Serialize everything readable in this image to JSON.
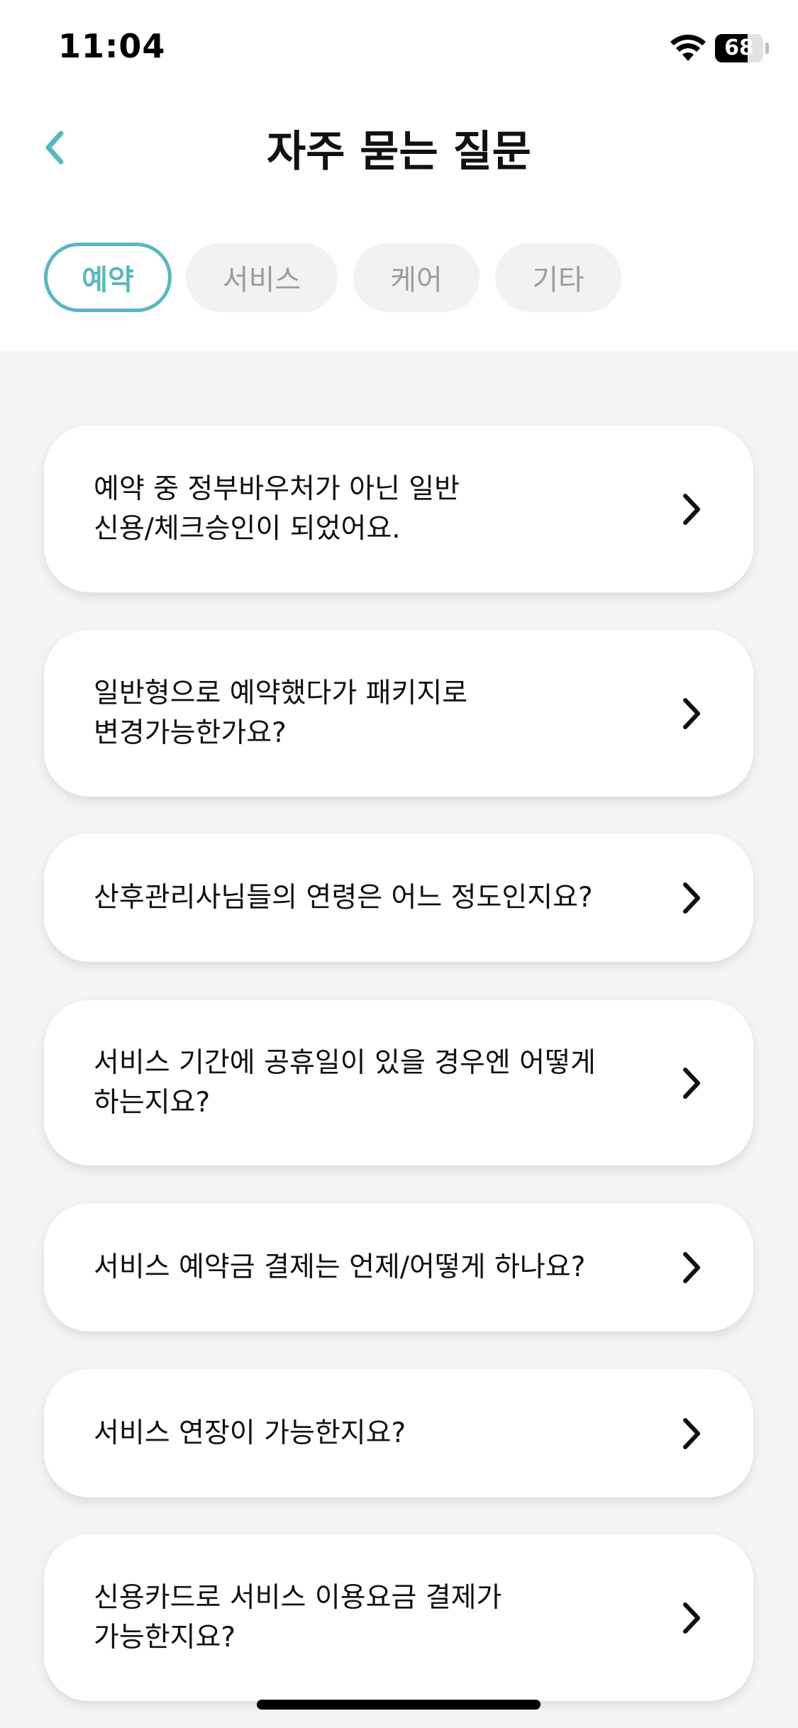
{
  "status_bar": {
    "time": "11:04",
    "battery_percent": 68,
    "battery_label": "68",
    "wifi_icon": "wifi-icon"
  },
  "header": {
    "title": "자주 묻는 질문",
    "back_icon": "chevron-left-icon"
  },
  "tabs": [
    {
      "label": "예약",
      "active": true
    },
    {
      "label": "서비스",
      "active": false
    },
    {
      "label": "케어",
      "active": false
    },
    {
      "label": "기타",
      "active": false
    }
  ],
  "faq_items": [
    {
      "question": "예약 중 정부바우처가 아닌 일반\n신용/체크승인이 되었어요."
    },
    {
      "question": "일반형으로 예약했다가 패키지로\n변경가능한가요?"
    },
    {
      "question": "산후관리사님들의 연령은 어느 정도인지요?"
    },
    {
      "question": "서비스 기간에 공휴일이 있을 경우엔 어떻게\n하는지요?"
    },
    {
      "question": "서비스 예약금 결제는 언제/어떻게 하나요?"
    },
    {
      "question": "서비스 연장이 가능한지요?"
    },
    {
      "question": "신용카드로 서비스 이용요금 결제가\n가능한지요?"
    }
  ],
  "colors": {
    "accent": "#5ab8bd",
    "background": "#f4f4f4",
    "card": "#ffffff",
    "tab_inactive_bg": "#f2f2f2",
    "tab_inactive_text": "#9c9c9c"
  }
}
